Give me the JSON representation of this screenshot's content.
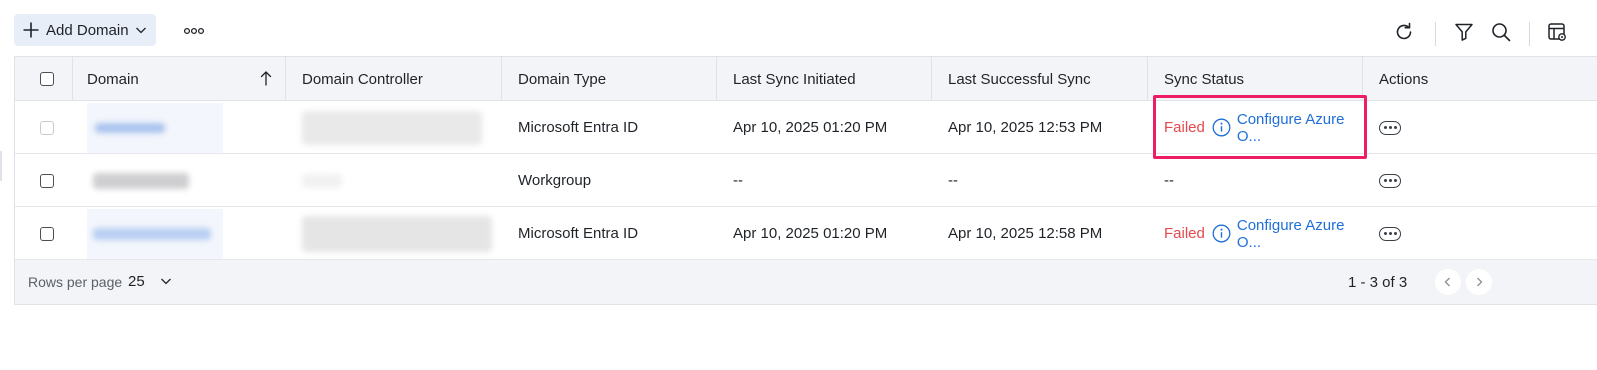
{
  "toolbar": {
    "add_domain_label": "Add Domain",
    "add_icon": "plus-icon",
    "dropdown_icon": "chevron-down-icon",
    "more_icon": "more-dots-icon",
    "right_icons": [
      "refresh-icon",
      "filter-icon",
      "search-icon",
      "table-settings-icon"
    ]
  },
  "table": {
    "columns": {
      "domain": "Domain",
      "domain_controller": "Domain Controller",
      "domain_type": "Domain Type",
      "last_sync_initiated": "Last Sync Initiated",
      "last_successful_sync": "Last Successful Sync",
      "sync_status": "Sync Status",
      "actions": "Actions"
    },
    "rows": [
      {
        "domain_type": "Microsoft Entra ID",
        "last_sync_initiated": "Apr 10, 2025 01:20 PM",
        "last_successful_sync": "Apr 10, 2025 12:53 PM",
        "status": "Failed",
        "configure": "Configure Azure O..."
      },
      {
        "domain_type": "Workgroup",
        "last_sync_initiated": "--",
        "last_successful_sync": "--",
        "status": "--",
        "configure": ""
      },
      {
        "domain_type": "Microsoft Entra ID",
        "last_sync_initiated": "Apr 10, 2025 01:20 PM",
        "last_successful_sync": "Apr 10, 2025 12:58 PM",
        "status": "Failed",
        "configure": "Configure Azure O..."
      }
    ]
  },
  "footer": {
    "rows_per_page_label": "Rows per page",
    "rows_per_page_value": "25",
    "page_range": "1 - 3 of 3"
  },
  "colors": {
    "failed": "#e5484d",
    "link": "#1e6fd9",
    "highlight": "#ec1d62",
    "header_bg": "#f3f4f7"
  }
}
